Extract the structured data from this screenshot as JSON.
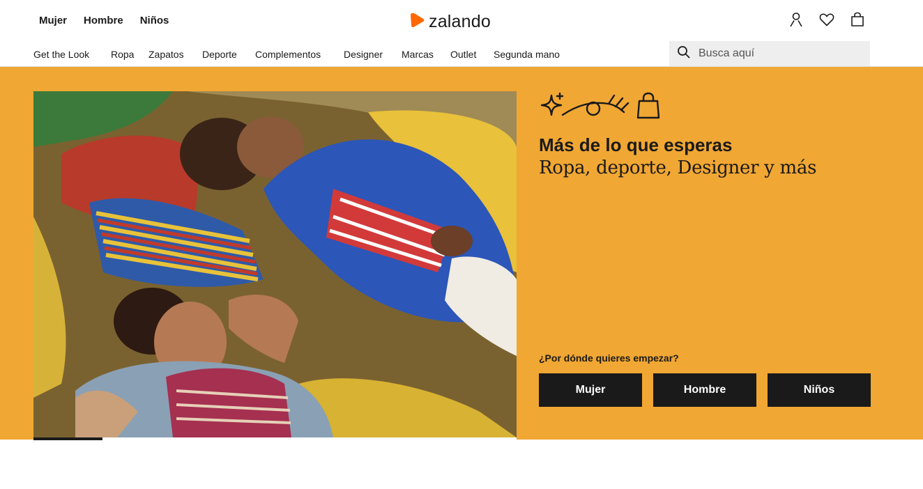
{
  "header": {
    "gender_nav": [
      "Mujer",
      "Hombre",
      "Niños"
    ],
    "logo_text": "zalando",
    "icons": [
      "user-account-icon",
      "wishlist-heart-icon",
      "shopping-bag-icon"
    ]
  },
  "category_nav": [
    "Get the Look",
    "Ropa",
    "Zapatos",
    "Deporte",
    "Complementos",
    "Designer",
    "Marcas",
    "Outlet",
    "Segunda mano"
  ],
  "search": {
    "placeholder": "Busca aquí"
  },
  "hero": {
    "headline": "Más de lo que esperas",
    "subline": "Ropa, deporte, Designer y más",
    "prompt": "¿Por dónde quieres empezar?",
    "cta_buttons": [
      "Mujer",
      "Hombre",
      "Niños"
    ],
    "slide_progress": 0.143
  },
  "colors": {
    "brand_orange": "#ff6900",
    "hero_background": "#f1a733",
    "button_background": "#1a1a1a",
    "search_background": "#eeeeee"
  }
}
